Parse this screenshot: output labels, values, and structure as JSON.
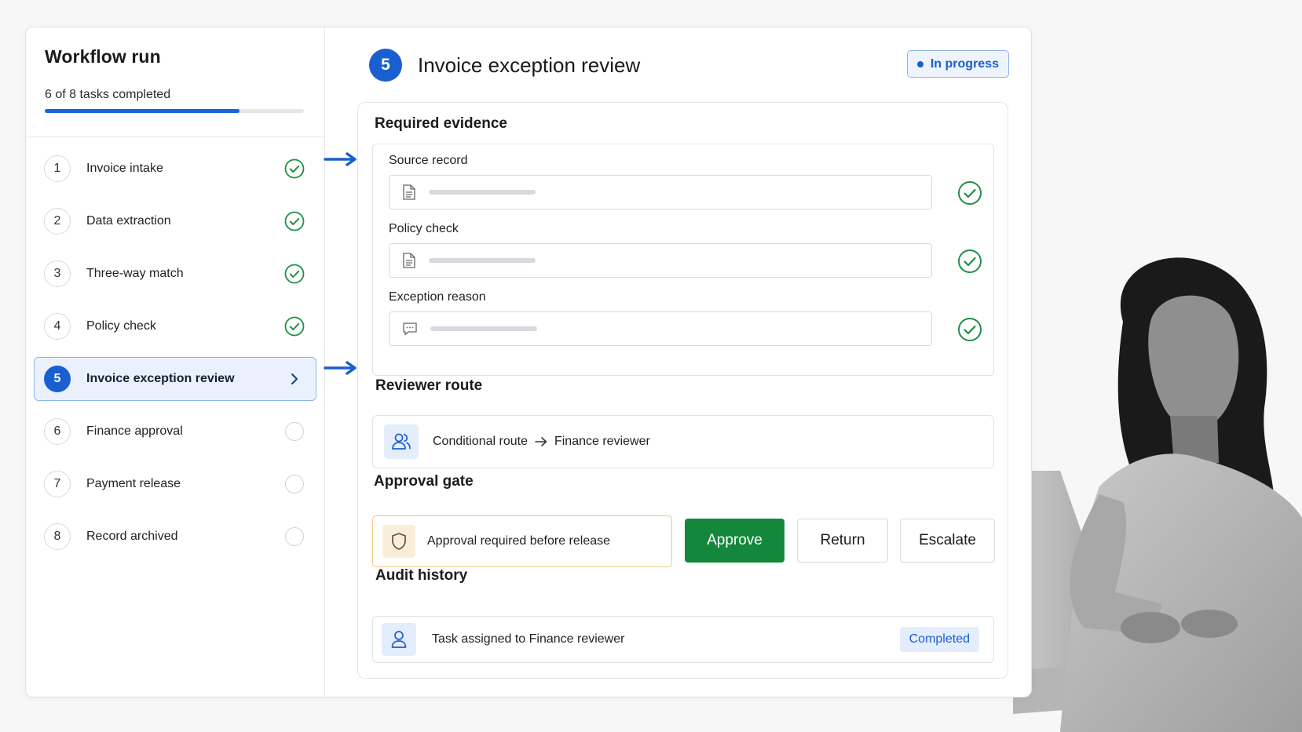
{
  "sidebar": {
    "title": "Workflow run",
    "progress_text": "6 of 8 tasks completed",
    "progress_fraction": 0.75,
    "steps": [
      {
        "num": "1",
        "label": "Invoice intake",
        "status": "done"
      },
      {
        "num": "2",
        "label": "Data extraction",
        "status": "done"
      },
      {
        "num": "3",
        "label": "Three-way match",
        "status": "done"
      },
      {
        "num": "4",
        "label": "Policy check",
        "status": "done"
      },
      {
        "num": "5",
        "label": "Invoice exception review",
        "status": "active"
      },
      {
        "num": "6",
        "label": "Finance approval",
        "status": "pending"
      },
      {
        "num": "7",
        "label": "Payment release",
        "status": "pending"
      },
      {
        "num": "8",
        "label": "Record archived",
        "status": "pending"
      }
    ]
  },
  "main": {
    "step_num": "5",
    "title": "Invoice exception review",
    "status_badge": "In progress",
    "evidence": {
      "title": "Required evidence",
      "items": [
        {
          "label": "Source record",
          "icon": "document-icon"
        },
        {
          "label": "Policy check",
          "icon": "document-icon"
        },
        {
          "label": "Exception reason",
          "icon": "comment-icon"
        }
      ]
    },
    "route": {
      "title": "Reviewer route",
      "from": "Conditional route",
      "to": "Finance reviewer",
      "icon": "users-icon"
    },
    "gate": {
      "title": "Approval gate",
      "text": "Approval required before release",
      "icon": "shield-icon",
      "approve_label": "Approve",
      "return_label": "Return",
      "escalate_label": "Escalate"
    },
    "audit": {
      "title": "Audit history",
      "text": "Task assigned to Finance reviewer",
      "badge": "Completed",
      "icon": "user-icon"
    }
  },
  "colors": {
    "accent": "#1a5fd0",
    "success": "#13883c",
    "check": "#1f8f45",
    "warning_border": "#f2c77e"
  }
}
